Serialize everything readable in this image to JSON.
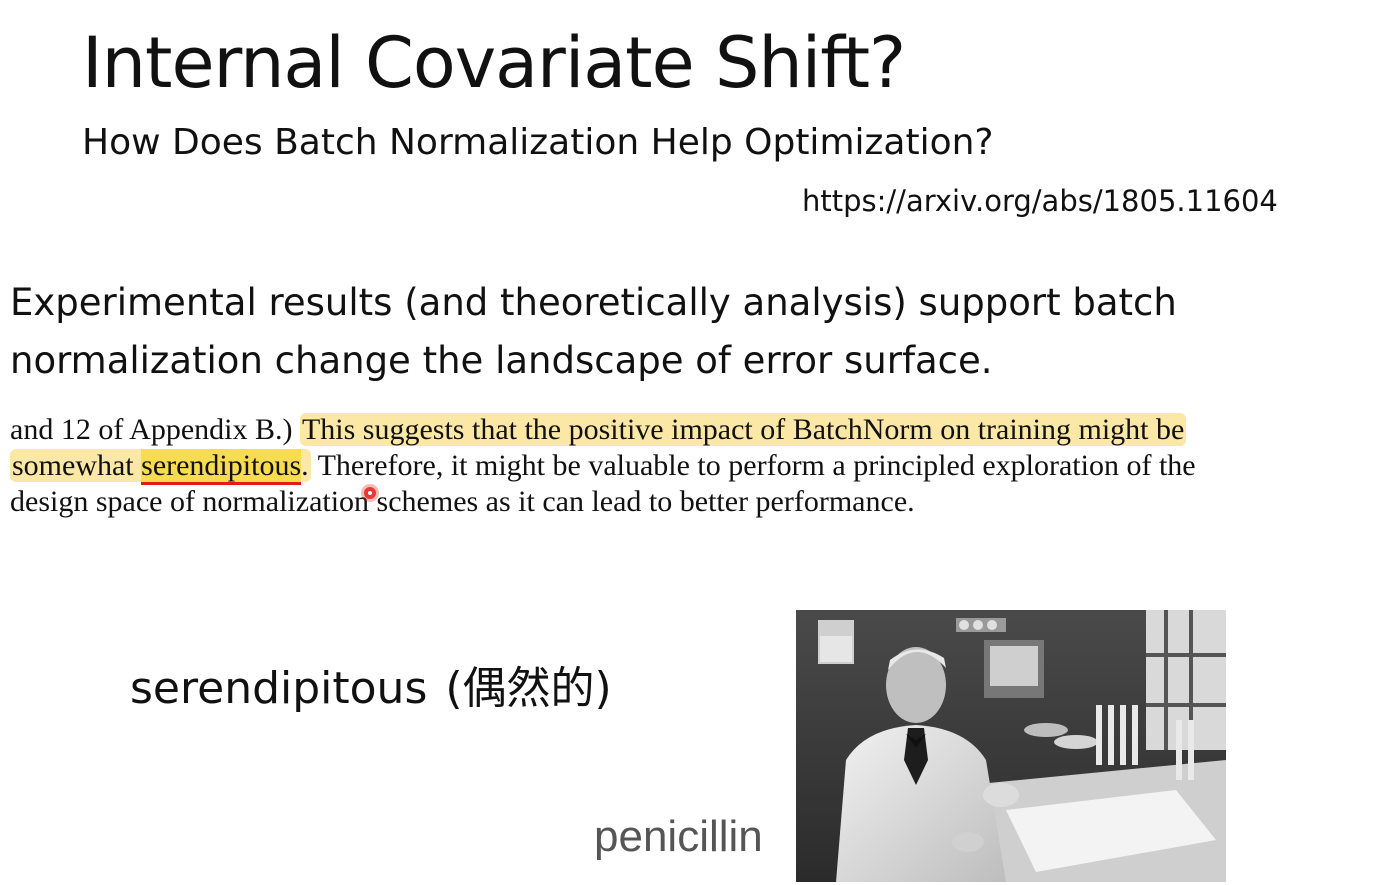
{
  "slide": {
    "title": "Internal Covariate Shift?",
    "subtitle": "How Does Batch Normalization Help Optimization?",
    "url": "https://arxiv.org/abs/1805.11604",
    "summary_lines": [
      "Experimental results (and theoretically analysis) support batch",
      "normalization change the landscape of error surface."
    ]
  },
  "quote": {
    "line1_plain": "and 12 of Appendix B.) ",
    "line1_highlight": "This suggests that the positive impact of BatchNorm on training might be",
    "line2_highlight_pre": "somewhat ",
    "line2_keyword": "serendipitous",
    "line2_highlight_post": ".",
    "line2_plain": " Therefore, it might be valuable to perform a principled exploration of the",
    "line3_plain": "design space of normalization schemes as it can lead to better performance."
  },
  "vocab": {
    "word": "serendipitous",
    "gloss": "(偶然的)"
  },
  "photo": {
    "caption": "penicillin"
  },
  "colors": {
    "highlight": "#fbe7a6",
    "keyword_highlight": "#f6dc4e",
    "keyword_underline": "#e31b1b",
    "cursor": "#e53935"
  }
}
